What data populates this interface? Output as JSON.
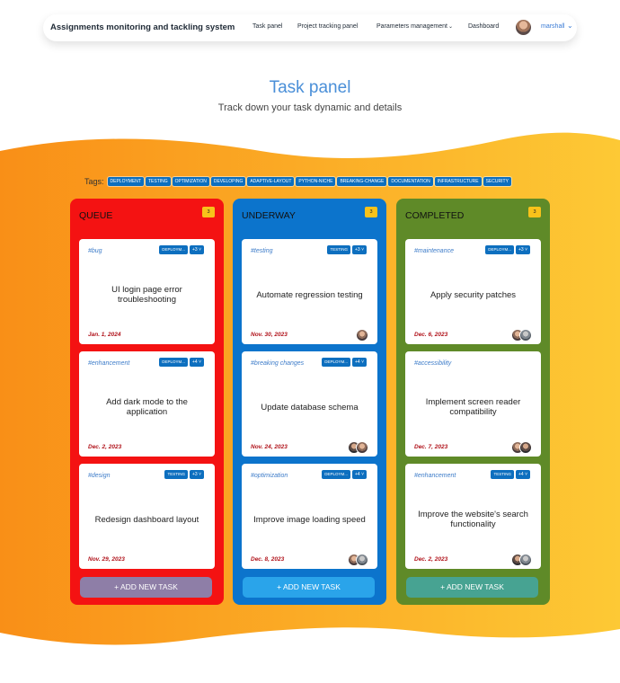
{
  "nav": {
    "brand": "Assignments monitoring and tackling system",
    "links": [
      "Task panel",
      "Project tracking panel",
      "Parameters management",
      "Dashboard"
    ],
    "user": "marshall"
  },
  "header": {
    "title": "Task panel",
    "subtitle": "Track down your task dynamic and details"
  },
  "tags": {
    "label": "Tags:",
    "items": [
      "DEPLOYMENT",
      "TESTING",
      "OPTIMIZATION",
      "DEVELOPING",
      "ADAPTIVE-LAYOUT",
      "PYTHON-NICHE",
      "BREAKING-CHANGE",
      "DOCUMENTATION",
      "INFRASTRUCTURE",
      "SECURITY"
    ]
  },
  "add_label": "+ ADD NEW TASK",
  "columns": [
    {
      "title": "QUEUE",
      "count": "3",
      "cards": [
        {
          "label": "#bug",
          "badge": "DEPLOYM...",
          "more": "+3",
          "title": "UI login page error troubleshooting",
          "date": "Jan. 1, 2024",
          "avatars": []
        },
        {
          "label": "#enhancement",
          "badge": "DEPLOYM...",
          "more": "+4",
          "title": "Add dark mode to the application",
          "date": "Dec. 2, 2023",
          "avatars": []
        },
        {
          "label": "#design",
          "badge": "TESTING",
          "more": "+3",
          "title": "Redesign dashboard layout",
          "date": "Nov. 29, 2023",
          "avatars": []
        }
      ]
    },
    {
      "title": "UNDERWAY",
      "count": "3",
      "cards": [
        {
          "label": "#testing",
          "badge": "TESTING",
          "more": "+3",
          "title": "Automate regression testing",
          "date": "Nov. 30, 2023",
          "avatars": [
            "a"
          ]
        },
        {
          "label": "#breaking changes",
          "badge": "DEPLOYM...",
          "more": "+4",
          "title": "Update database schema",
          "date": "Nov. 24, 2023",
          "avatars": [
            "b",
            "a"
          ]
        },
        {
          "label": "#optimization",
          "badge": "DEPLOYM...",
          "more": "+4",
          "title": "Improve image loading speed",
          "date": "Dec. 8, 2023",
          "avatars": [
            "a",
            "c"
          ]
        }
      ]
    },
    {
      "title": "COMPLETED",
      "count": "3",
      "cards": [
        {
          "label": "#maintenance",
          "badge": "DEPLOYM...",
          "more": "+3",
          "title": "Apply security patches",
          "date": "Dec. 6, 2023",
          "avatars": [
            "a",
            "c"
          ]
        },
        {
          "label": "#accessibility",
          "badge": "",
          "more": "",
          "title": "Implement screen reader compatibility",
          "date": "Dec. 7, 2023",
          "avatars": [
            "a",
            "b"
          ]
        },
        {
          "label": "#enhancement",
          "badge": "TESTING",
          "more": "+4",
          "title": "Improve the website's search functionality",
          "date": "Dec. 2, 2023",
          "avatars": [
            "b",
            "c"
          ]
        }
      ]
    }
  ],
  "colors": {
    "queue": "#f41212",
    "underway": "#0c74cc",
    "completed": "#5f8a28",
    "accent": "#4a8fd8",
    "tag_chip": "#0d6fbf",
    "count_badge": "#f8c21a"
  }
}
